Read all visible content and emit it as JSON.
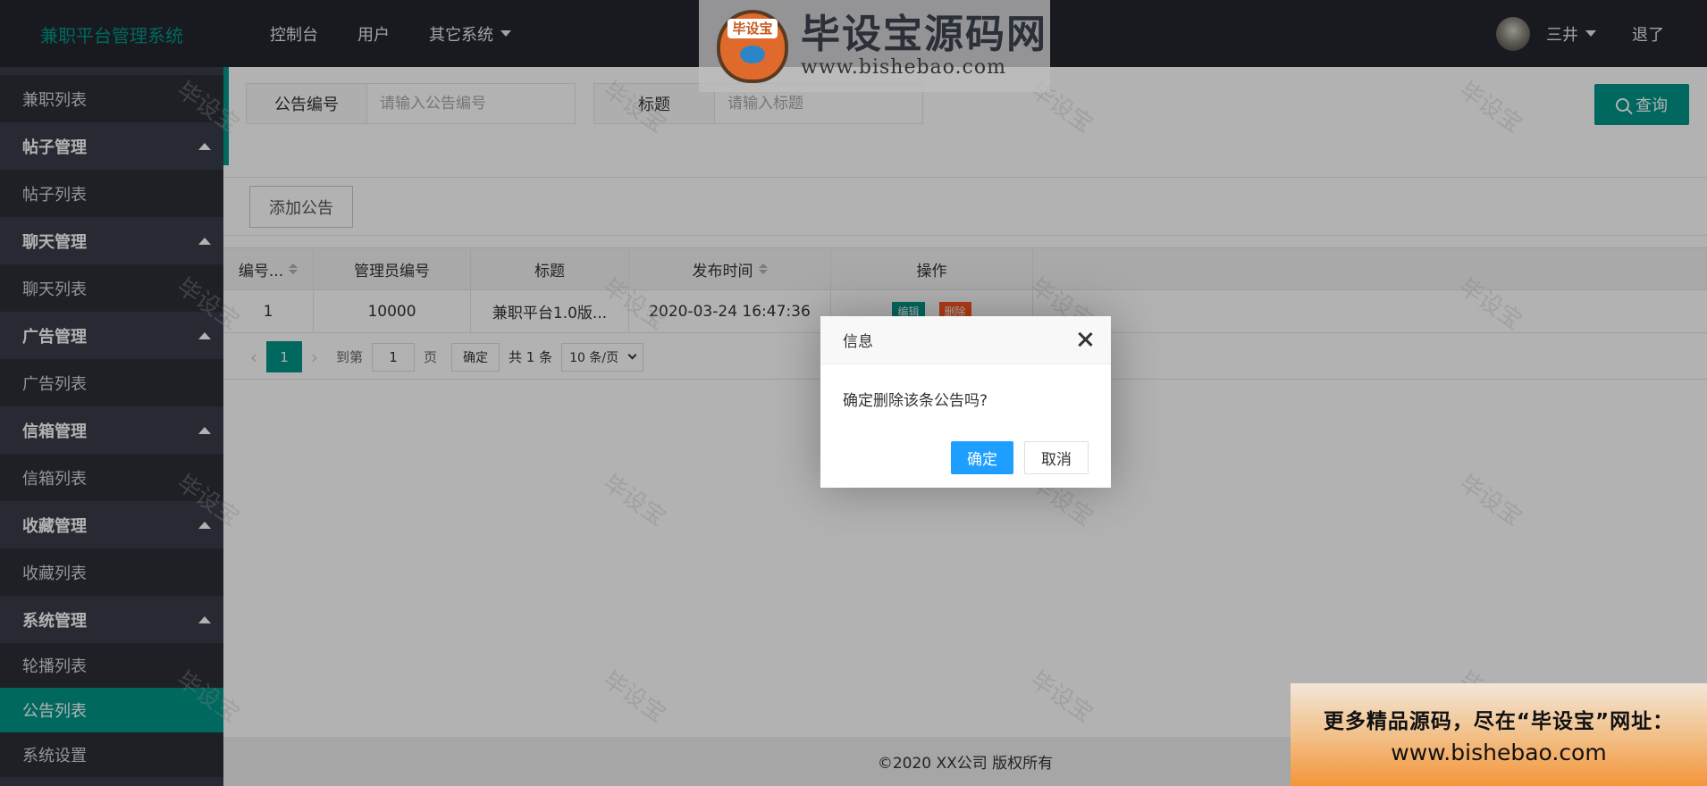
{
  "header": {
    "logo": "兼职平台管理系统",
    "nav": [
      "控制台",
      "用户",
      "其它系统"
    ],
    "user_name": "三井",
    "logout": "退了"
  },
  "sidebar": {
    "items": [
      {
        "label": "兼职列表",
        "type": "sub"
      },
      {
        "label": "帖子管理",
        "type": "head"
      },
      {
        "label": "帖子列表",
        "type": "sub"
      },
      {
        "label": "聊天管理",
        "type": "head"
      },
      {
        "label": "聊天列表",
        "type": "sub"
      },
      {
        "label": "广告管理",
        "type": "head"
      },
      {
        "label": "广告列表",
        "type": "sub"
      },
      {
        "label": "信箱管理",
        "type": "head"
      },
      {
        "label": "信箱列表",
        "type": "sub"
      },
      {
        "label": "收藏管理",
        "type": "head"
      },
      {
        "label": "收藏列表",
        "type": "sub"
      },
      {
        "label": "系统管理",
        "type": "head"
      },
      {
        "label": "轮播列表",
        "type": "sub"
      },
      {
        "label": "公告列表",
        "type": "sub",
        "active": true
      },
      {
        "label": "系统设置",
        "type": "sub"
      }
    ]
  },
  "search": {
    "field1_label": "公告编号",
    "field1_placeholder": "请输入公告编号",
    "field2_label": "标题",
    "field2_placeholder": "请输入标题",
    "query_label": "查询"
  },
  "toolbar": {
    "add_label": "添加公告"
  },
  "table": {
    "headers": [
      "编号...",
      "管理员编号",
      "标题",
      "发布时间",
      "操作"
    ],
    "rows": [
      {
        "id": "1",
        "admin_id": "10000",
        "title": "兼职平台1.0版...",
        "time": "2020-03-24 16:47:36",
        "edit": "编辑",
        "delete": "删除"
      }
    ]
  },
  "pager": {
    "current": "1",
    "goto_label": "到第",
    "page_value": "1",
    "page_unit": "页",
    "confirm": "确定",
    "total": "共 1 条",
    "page_size": "10 条/页"
  },
  "footer": {
    "copyright": "©2020 XX公司 版权所有"
  },
  "dialog": {
    "title": "信息",
    "message": "确定删除该条公告吗?",
    "ok": "确定",
    "cancel": "取消"
  },
  "watermark": {
    "text": "毕设宝",
    "banner_cn": "毕设宝源码网",
    "banner_badge": "毕设宝",
    "banner_en": "www.bishebao.com",
    "promo_line1": "更多精品源码，尽在“毕设宝”网址：",
    "promo_line2": "www.bishebao.com"
  },
  "colors": {
    "accent": "#009688",
    "header_bg": "#23262e",
    "sidebar_bg": "#393d49",
    "danger": "#FF5722",
    "dialog_ok": "#1E9FFF"
  }
}
